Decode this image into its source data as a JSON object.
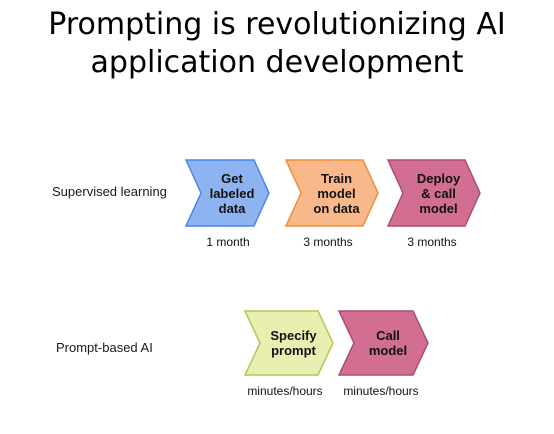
{
  "title": {
    "line1": "Prompting is revolutionizing AI",
    "line2": "application development"
  },
  "rows": [
    {
      "label": "Supervised learning",
      "steps": [
        {
          "lines": [
            "Get",
            "labeled",
            "data"
          ],
          "duration": "1 month",
          "fill": "#8db3f0",
          "stroke": "#4a86e8"
        },
        {
          "lines": [
            "Train",
            "model",
            "on data"
          ],
          "duration": "3 months",
          "fill": "#f9b88a",
          "stroke": "#e69138"
        },
        {
          "lines": [
            "Deploy",
            "& call",
            "model"
          ],
          "duration": "3 months",
          "fill": "#d36e93",
          "stroke": "#a64d79"
        }
      ]
    },
    {
      "label": "Prompt-based AI",
      "steps": [
        {
          "lines": [
            "Specify",
            "prompt"
          ],
          "duration": "minutes/hours",
          "fill": "#e8efb0",
          "stroke": "#b8c454"
        },
        {
          "lines": [
            "Call",
            "model"
          ],
          "duration": "minutes/hours",
          "fill": "#d36e93",
          "stroke": "#a64d79"
        }
      ]
    }
  ]
}
